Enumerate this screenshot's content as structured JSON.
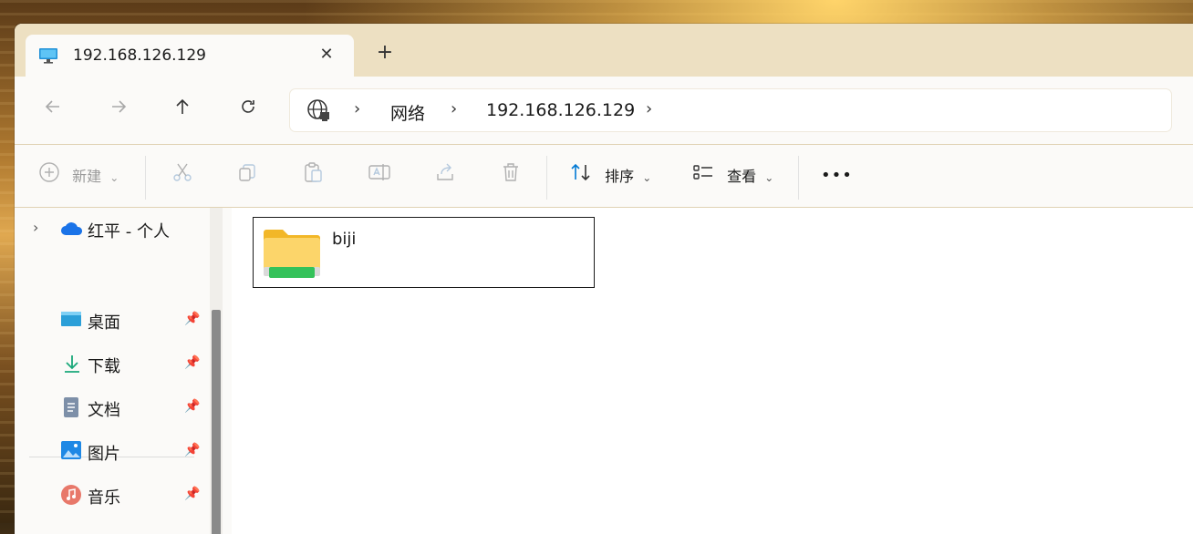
{
  "window": {
    "tab_title": "192.168.126.129",
    "tab_icon": "monitor-icon"
  },
  "nav": {
    "back_icon": "arrow-left-icon",
    "forward_icon": "arrow-right-icon",
    "up_icon": "arrow-up-icon",
    "refresh_icon": "refresh-icon"
  },
  "address": {
    "root_icon": "network-globe-icon",
    "crumbs": [
      "网络",
      "192.168.126.129"
    ]
  },
  "toolbar": {
    "new_label": "新建",
    "sort_label": "排序",
    "view_label": "查看",
    "more_label": "•••",
    "icons": [
      "cut-icon",
      "copy-icon",
      "paste-icon",
      "rename-icon",
      "share-icon",
      "delete-icon"
    ]
  },
  "sidebar": {
    "onedrive_label": "红平 - 个人",
    "items": [
      {
        "label": "桌面",
        "icon": "desktop-icon"
      },
      {
        "label": "下载",
        "icon": "download-icon"
      },
      {
        "label": "文档",
        "icon": "document-icon"
      },
      {
        "label": "图片",
        "icon": "pictures-icon"
      },
      {
        "label": "音乐",
        "icon": "music-icon"
      }
    ]
  },
  "content": {
    "folders": [
      {
        "name": "biji",
        "icon": "network-folder-icon"
      }
    ]
  },
  "colors": {
    "titlebar": "#ede0c2",
    "accent": "#0078d4",
    "folder": "#f8c940"
  }
}
